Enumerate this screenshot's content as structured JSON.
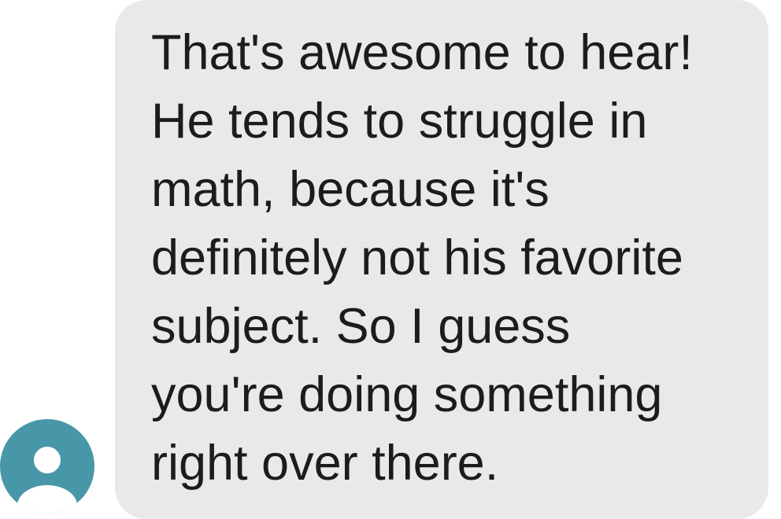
{
  "conversation": {
    "incoming_message": {
      "avatar_icon": "person-icon",
      "avatar_color": "#4797a8",
      "bubble_color": "#e9e9eb",
      "text": "That's awesome to hear!\nHe tends to struggle in\nmath, because it's\ndefinitely not his favorite\nsubject. So I guess\nyou're doing something\nright over there."
    }
  }
}
